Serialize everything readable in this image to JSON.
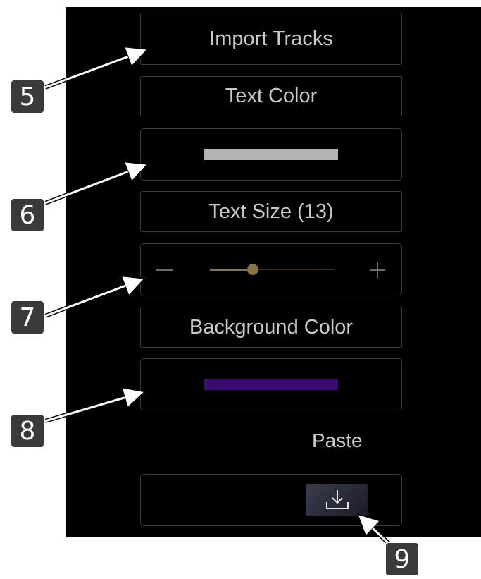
{
  "buttons": {
    "import_tracks": "Import Tracks",
    "text_color": "Text Color",
    "text_size": "Text Size (13)",
    "background_color": "Background Color",
    "paste": "Paste"
  },
  "colors": {
    "text_color_swatch": "#b3b3b3",
    "background_color_swatch": "#3a0c6e",
    "slider_accent": "#8a7444"
  },
  "text_size_slider": {
    "value": 13,
    "fraction": 0.34
  },
  "icons": {
    "import_icon": "download-tray-icon"
  },
  "callouts": [
    "5",
    "6",
    "7",
    "8",
    "9"
  ]
}
